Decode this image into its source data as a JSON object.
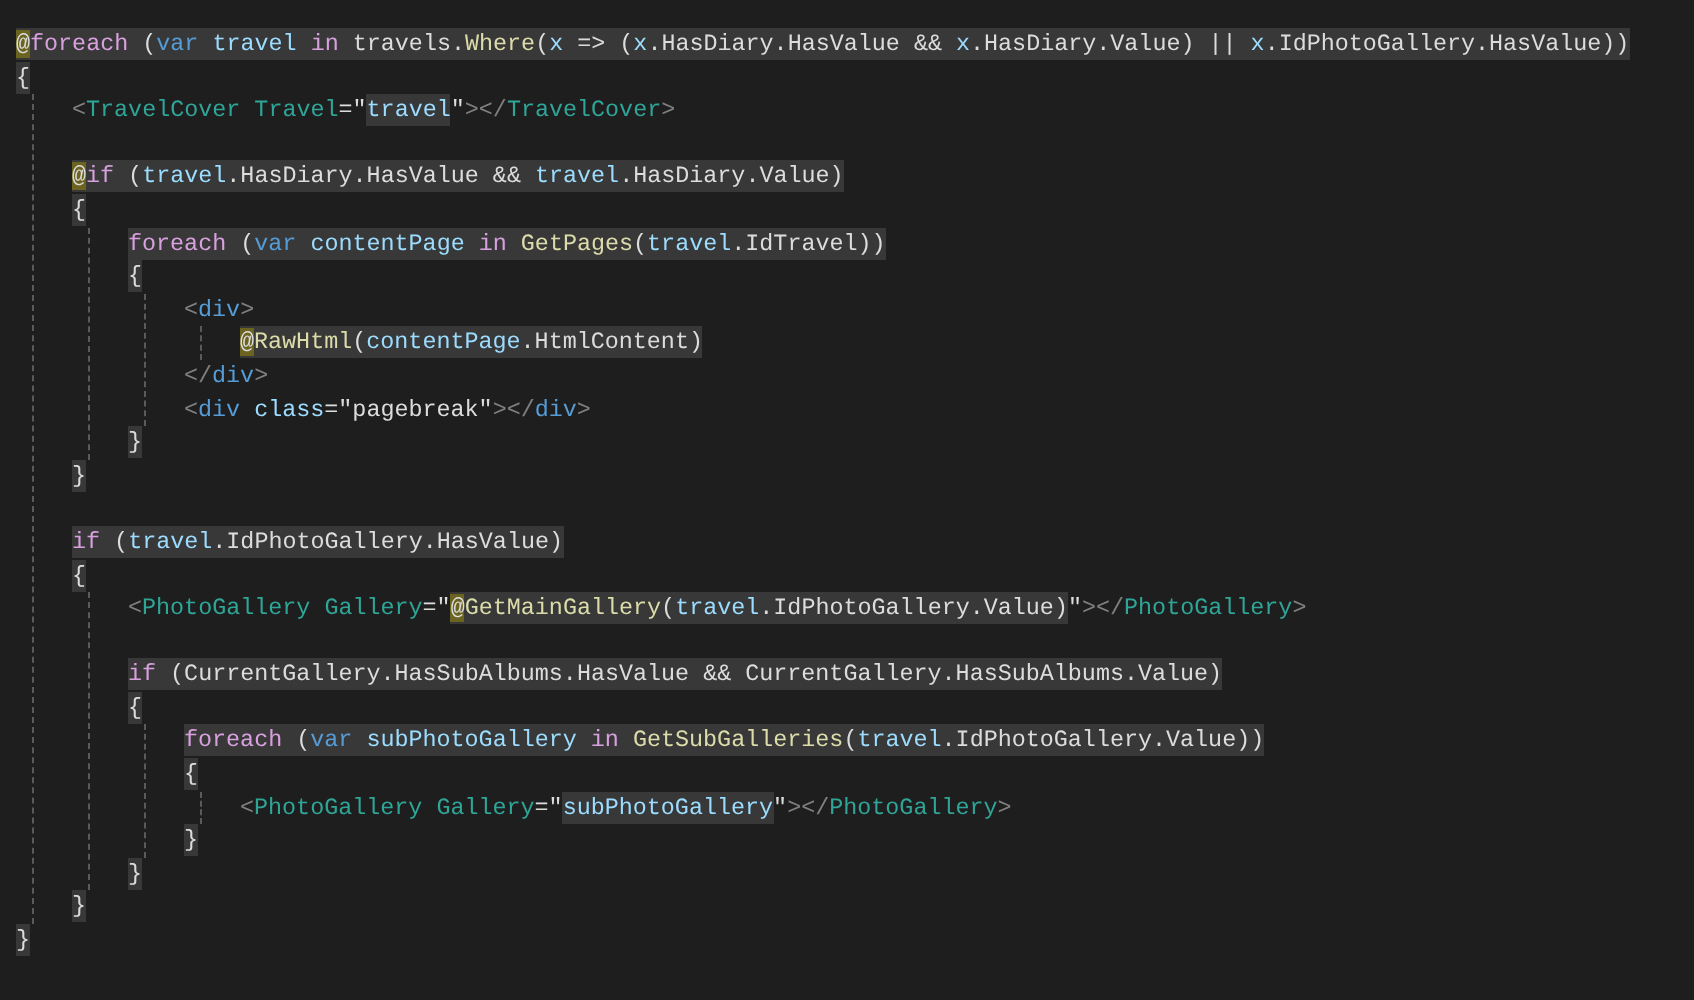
{
  "editor": {
    "lines": [
      {
        "kind": "code",
        "segments": [
          {
            "highlighted": true,
            "tokens": [
              {
                "kind": "razor",
                "text": "@"
              },
              {
                "kind": "control",
                "text": "foreach"
              },
              {
                "kind": "plain",
                "text": " ("
              },
              {
                "kind": "keyword",
                "text": "var "
              },
              {
                "kind": "variable",
                "text": "travel "
              },
              {
                "kind": "control",
                "text": "in"
              },
              {
                "kind": "plain",
                "text": " travels."
              },
              {
                "kind": "method",
                "text": "Where"
              },
              {
                "kind": "plain",
                "text": "("
              },
              {
                "kind": "variable",
                "text": "x"
              },
              {
                "kind": "plain",
                "text": " => ("
              },
              {
                "kind": "variable",
                "text": "x"
              },
              {
                "kind": "plain",
                "text": ".HasDiary.HasValue && "
              },
              {
                "kind": "variable",
                "text": "x"
              },
              {
                "kind": "plain",
                "text": ".HasDiary.Value) || "
              },
              {
                "kind": "variable",
                "text": "x"
              },
              {
                "kind": "plain",
                "text": ".IdPhotoGallery.HasValue))"
              }
            ]
          }
        ]
      },
      {
        "kind": "code",
        "segments": [
          {
            "highlighted": true,
            "tokens": [
              {
                "kind": "plain",
                "text": "{"
              }
            ]
          }
        ],
        "children": [
          {
            "kind": "code",
            "segments": [
              {
                "highlighted": false,
                "tokens": [
                  {
                    "kind": "bracket",
                    "text": "<"
                  },
                  {
                    "kind": "component",
                    "text": "TravelCover Travel"
                  },
                  {
                    "kind": "plain",
                    "text": "=\""
                  }
                ]
              },
              {
                "highlighted": true,
                "tokens": [
                  {
                    "kind": "variable",
                    "text": "travel"
                  }
                ]
              },
              {
                "highlighted": false,
                "tokens": [
                  {
                    "kind": "plain",
                    "text": "\""
                  },
                  {
                    "kind": "bracket",
                    "text": "></"
                  },
                  {
                    "kind": "component",
                    "text": "TravelCover"
                  },
                  {
                    "kind": "bracket",
                    "text": ">"
                  }
                ]
              }
            ]
          },
          {
            "kind": "blank"
          },
          {
            "kind": "code",
            "segments": [
              {
                "highlighted": true,
                "tokens": [
                  {
                    "kind": "razor",
                    "text": "@"
                  },
                  {
                    "kind": "control",
                    "text": "if"
                  },
                  {
                    "kind": "plain",
                    "text": " ("
                  },
                  {
                    "kind": "variable",
                    "text": "travel"
                  },
                  {
                    "kind": "plain",
                    "text": ".HasDiary.HasValue && "
                  },
                  {
                    "kind": "variable",
                    "text": "travel"
                  },
                  {
                    "kind": "plain",
                    "text": ".HasDiary.Value)"
                  }
                ]
              }
            ]
          },
          {
            "kind": "code",
            "segments": [
              {
                "highlighted": true,
                "tokens": [
                  {
                    "kind": "plain",
                    "text": "{"
                  }
                ]
              }
            ],
            "children": [
              {
                "kind": "code",
                "segments": [
                  {
                    "highlighted": true,
                    "tokens": [
                      {
                        "kind": "control",
                        "text": "foreach"
                      },
                      {
                        "kind": "plain",
                        "text": " ("
                      },
                      {
                        "kind": "keyword",
                        "text": "var "
                      },
                      {
                        "kind": "variable",
                        "text": "contentPage "
                      },
                      {
                        "kind": "control",
                        "text": "in "
                      },
                      {
                        "kind": "method",
                        "text": "GetPages"
                      },
                      {
                        "kind": "plain",
                        "text": "("
                      },
                      {
                        "kind": "variable",
                        "text": "travel"
                      },
                      {
                        "kind": "plain",
                        "text": ".IdTravel))"
                      }
                    ]
                  }
                ]
              },
              {
                "kind": "code",
                "segments": [
                  {
                    "highlighted": true,
                    "tokens": [
                      {
                        "kind": "plain",
                        "text": "{"
                      }
                    ]
                  }
                ],
                "children": [
                  {
                    "kind": "code",
                    "segments": [
                      {
                        "highlighted": false,
                        "tokens": [
                          {
                            "kind": "bracket",
                            "text": "<"
                          },
                          {
                            "kind": "html",
                            "text": "div"
                          },
                          {
                            "kind": "bracket",
                            "text": ">"
                          }
                        ]
                      }
                    ],
                    "children": [
                      {
                        "kind": "code",
                        "segments": [
                          {
                            "highlighted": true,
                            "tokens": [
                              {
                                "kind": "razor",
                                "text": "@"
                              },
                              {
                                "kind": "method",
                                "text": "RawHtml"
                              },
                              {
                                "kind": "plain",
                                "text": "("
                              },
                              {
                                "kind": "variable",
                                "text": "contentPage"
                              },
                              {
                                "kind": "plain",
                                "text": ".HtmlContent)"
                              }
                            ]
                          }
                        ]
                      }
                    ]
                  },
                  {
                    "kind": "code",
                    "segments": [
                      {
                        "highlighted": false,
                        "tokens": [
                          {
                            "kind": "bracket",
                            "text": "</"
                          },
                          {
                            "kind": "html",
                            "text": "div"
                          },
                          {
                            "kind": "bracket",
                            "text": ">"
                          }
                        ]
                      }
                    ]
                  },
                  {
                    "kind": "code",
                    "segments": [
                      {
                        "highlighted": false,
                        "tokens": [
                          {
                            "kind": "bracket",
                            "text": "<"
                          },
                          {
                            "kind": "html",
                            "text": "div "
                          },
                          {
                            "kind": "attr",
                            "text": "class"
                          },
                          {
                            "kind": "plain",
                            "text": "=\"pagebreak\""
                          },
                          {
                            "kind": "bracket",
                            "text": "></"
                          },
                          {
                            "kind": "html",
                            "text": "div"
                          },
                          {
                            "kind": "bracket",
                            "text": ">"
                          }
                        ]
                      }
                    ]
                  }
                ]
              },
              {
                "kind": "code",
                "segments": [
                  {
                    "highlighted": true,
                    "tokens": [
                      {
                        "kind": "plain",
                        "text": "}"
                      }
                    ]
                  }
                ]
              }
            ]
          },
          {
            "kind": "code",
            "segments": [
              {
                "highlighted": true,
                "tokens": [
                  {
                    "kind": "plain",
                    "text": "}"
                  }
                ]
              }
            ]
          },
          {
            "kind": "blank"
          },
          {
            "kind": "code",
            "segments": [
              {
                "highlighted": true,
                "tokens": [
                  {
                    "kind": "control",
                    "text": "if"
                  },
                  {
                    "kind": "plain",
                    "text": " ("
                  },
                  {
                    "kind": "variable",
                    "text": "travel"
                  },
                  {
                    "kind": "plain",
                    "text": ".IdPhotoGallery.HasValue)"
                  }
                ]
              }
            ]
          },
          {
            "kind": "code",
            "segments": [
              {
                "highlighted": true,
                "tokens": [
                  {
                    "kind": "plain",
                    "text": "{"
                  }
                ]
              }
            ],
            "children": [
              {
                "kind": "code",
                "segments": [
                  {
                    "highlighted": false,
                    "tokens": [
                      {
                        "kind": "bracket",
                        "text": "<"
                      },
                      {
                        "kind": "component",
                        "text": "PhotoGallery Gallery"
                      },
                      {
                        "kind": "plain",
                        "text": "=\""
                      }
                    ]
                  },
                  {
                    "highlighted": true,
                    "tokens": [
                      {
                        "kind": "razor",
                        "text": "@"
                      },
                      {
                        "kind": "method",
                        "text": "GetMainGallery"
                      },
                      {
                        "kind": "plain",
                        "text": "("
                      },
                      {
                        "kind": "variable",
                        "text": "travel"
                      },
                      {
                        "kind": "plain",
                        "text": ".IdPhotoGallery.Value)"
                      }
                    ]
                  },
                  {
                    "highlighted": false,
                    "tokens": [
                      {
                        "kind": "plain",
                        "text": "\""
                      },
                      {
                        "kind": "bracket",
                        "text": "></"
                      },
                      {
                        "kind": "component",
                        "text": "PhotoGallery"
                      },
                      {
                        "kind": "bracket",
                        "text": ">"
                      }
                    ]
                  }
                ]
              },
              {
                "kind": "blank"
              },
              {
                "kind": "code",
                "segments": [
                  {
                    "highlighted": true,
                    "tokens": [
                      {
                        "kind": "control",
                        "text": "if"
                      },
                      {
                        "kind": "plain",
                        "text": " (CurrentGallery.HasSubAlbums.HasValue && CurrentGallery.HasSubAlbums.Value)"
                      }
                    ]
                  }
                ]
              },
              {
                "kind": "code",
                "segments": [
                  {
                    "highlighted": true,
                    "tokens": [
                      {
                        "kind": "plain",
                        "text": "{"
                      }
                    ]
                  }
                ],
                "children": [
                  {
                    "kind": "code",
                    "segments": [
                      {
                        "highlighted": true,
                        "tokens": [
                          {
                            "kind": "control",
                            "text": "foreach"
                          },
                          {
                            "kind": "plain",
                            "text": " ("
                          },
                          {
                            "kind": "keyword",
                            "text": "var "
                          },
                          {
                            "kind": "variable",
                            "text": "subPhotoGallery "
                          },
                          {
                            "kind": "control",
                            "text": "in "
                          },
                          {
                            "kind": "method",
                            "text": "GetSubGalleries"
                          },
                          {
                            "kind": "plain",
                            "text": "("
                          },
                          {
                            "kind": "variable",
                            "text": "travel"
                          },
                          {
                            "kind": "plain",
                            "text": ".IdPhotoGallery.Value))"
                          }
                        ]
                      }
                    ]
                  },
                  {
                    "kind": "code",
                    "segments": [
                      {
                        "highlighted": true,
                        "tokens": [
                          {
                            "kind": "plain",
                            "text": "{"
                          }
                        ]
                      }
                    ],
                    "children": [
                      {
                        "kind": "code",
                        "segments": [
                          {
                            "highlighted": false,
                            "tokens": [
                              {
                                "kind": "bracket",
                                "text": "<"
                              },
                              {
                                "kind": "component",
                                "text": "PhotoGallery Gallery"
                              },
                              {
                                "kind": "plain",
                                "text": "=\""
                              }
                            ]
                          },
                          {
                            "highlighted": true,
                            "tokens": [
                              {
                                "kind": "variable",
                                "text": "subPhotoGallery"
                              }
                            ]
                          },
                          {
                            "highlighted": false,
                            "tokens": [
                              {
                                "kind": "plain",
                                "text": "\""
                              },
                              {
                                "kind": "bracket",
                                "text": "></"
                              },
                              {
                                "kind": "component",
                                "text": "PhotoGallery"
                              },
                              {
                                "kind": "bracket",
                                "text": ">"
                              }
                            ]
                          }
                        ]
                      }
                    ]
                  },
                  {
                    "kind": "code",
                    "segments": [
                      {
                        "highlighted": true,
                        "tokens": [
                          {
                            "kind": "plain",
                            "text": "}"
                          }
                        ]
                      }
                    ]
                  }
                ]
              },
              {
                "kind": "code",
                "segments": [
                  {
                    "highlighted": true,
                    "tokens": [
                      {
                        "kind": "plain",
                        "text": "}"
                      }
                    ]
                  }
                ]
              }
            ]
          },
          {
            "kind": "code",
            "segments": [
              {
                "highlighted": true,
                "tokens": [
                  {
                    "kind": "plain",
                    "text": "}"
                  }
                ]
              }
            ]
          }
        ]
      },
      {
        "kind": "code",
        "segments": [
          {
            "highlighted": true,
            "tokens": [
              {
                "kind": "plain",
                "text": "}"
              }
            ]
          }
        ]
      }
    ]
  }
}
